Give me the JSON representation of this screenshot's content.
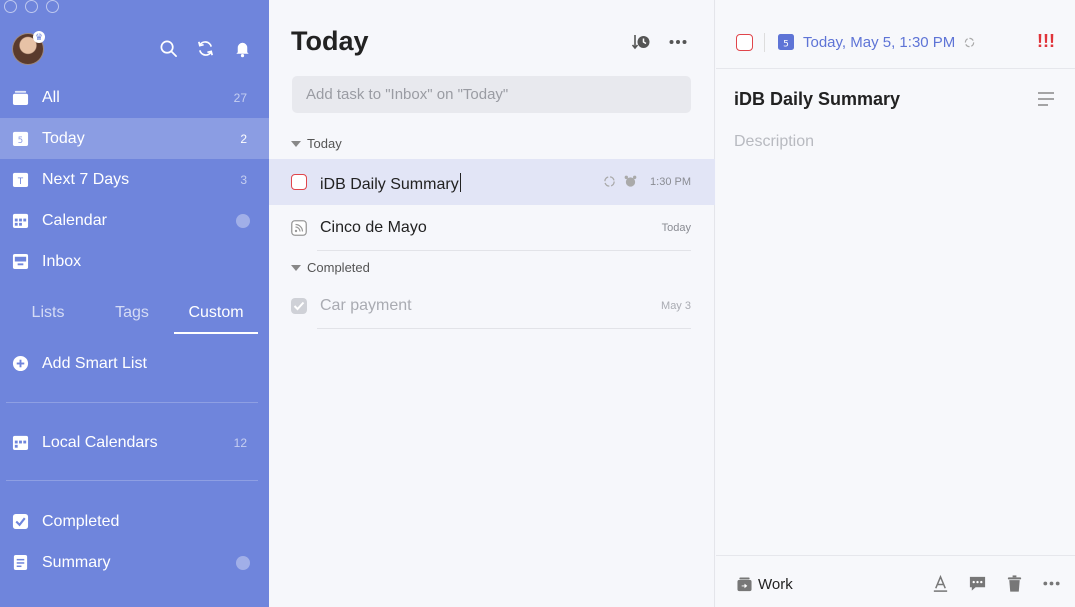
{
  "sidebar": {
    "nav": [
      {
        "label": "All",
        "count": "27",
        "icon": "inbox-stack-icon"
      },
      {
        "label": "Today",
        "count": "2",
        "icon": "calendar-day-icon",
        "icon_text": "5"
      },
      {
        "label": "Next 7 Days",
        "count": "3",
        "icon": "calendar-week-icon",
        "icon_text": "T"
      },
      {
        "label": "Calendar",
        "count": "",
        "icon": "calendar-icon"
      },
      {
        "label": "Inbox",
        "count": "",
        "icon": "inbox-icon"
      }
    ],
    "tabs": [
      {
        "label": "Lists"
      },
      {
        "label": "Tags"
      },
      {
        "label": "Custom"
      }
    ],
    "add_smart_list": "Add Smart List",
    "local_calendars": {
      "label": "Local Calendars",
      "count": "12"
    },
    "completed": "Completed",
    "summary": "Summary"
  },
  "middle": {
    "title": "Today",
    "add_placeholder": "Add task to \"Inbox\" on \"Today\"",
    "sections": [
      {
        "label": "Today"
      },
      {
        "label": "Completed"
      }
    ],
    "tasks": [
      {
        "name": "iDB Daily Summary",
        "date": "1:30 PM"
      },
      {
        "name": "Cinco de Mayo",
        "date": "Today"
      },
      {
        "name": "Car payment",
        "date": "May 3"
      }
    ]
  },
  "detail": {
    "calendar_day": "5",
    "date": "Today, May 5, 1:30 PM",
    "priority": "!!!",
    "title": "iDB Daily Summary",
    "description_placeholder": "Description",
    "list_name": "Work"
  },
  "colors": {
    "sidebar": "#6f85dc",
    "accent": "#5e74d6",
    "priority_high": "#e0343a"
  }
}
